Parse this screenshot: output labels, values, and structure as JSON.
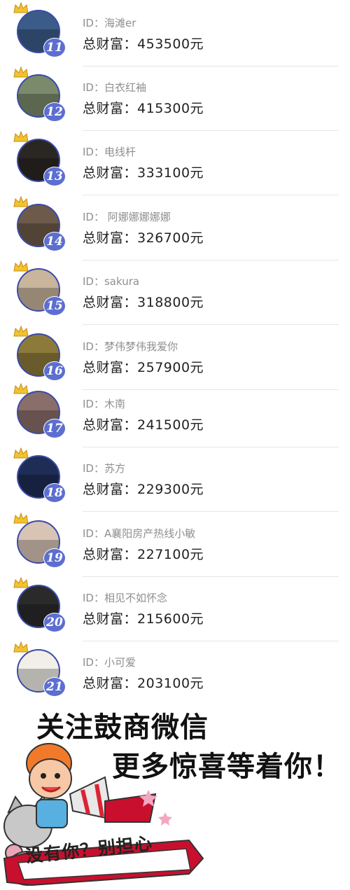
{
  "ranking": [
    {
      "rank": "11",
      "id_label": "ID：",
      "id": "海滩er",
      "wealth_label": "总财富：",
      "wealth": "453500元",
      "avatar_color": "#3b5c88"
    },
    {
      "rank": "12",
      "id_label": "ID：",
      "id": "白衣红袖",
      "wealth_label": "总财富：",
      "wealth": "415300元",
      "avatar_color": "#7a8a6a"
    },
    {
      "rank": "13",
      "id_label": "ID：",
      "id": "电线杆",
      "wealth_label": "总财富：",
      "wealth": "333100元",
      "avatar_color": "#2a2622"
    },
    {
      "rank": "14",
      "id_label": "ID：",
      "id": " 阿娜娜娜娜娜",
      "wealth_label": "总财富：",
      "wealth": "326700元",
      "avatar_color": "#6e5a4a"
    },
    {
      "rank": "15",
      "id_label": "ID：",
      "id": "sakura",
      "wealth_label": "总财富：",
      "wealth": "318800元",
      "avatar_color": "#c9b49c"
    },
    {
      "rank": "16",
      "id_label": "ID：",
      "id": "梦伟梦伟我爱你",
      "wealth_label": "总财富：",
      "wealth": "257900元",
      "avatar_color": "#8c7a3a"
    },
    {
      "rank": "17",
      "id_label": "ID：",
      "id": "木南",
      "wealth_label": "总财富：",
      "wealth": "241500元",
      "avatar_color": "#8a6e6a"
    },
    {
      "rank": "18",
      "id_label": "ID：",
      "id": "苏方",
      "wealth_label": "总财富：",
      "wealth": "229300元",
      "avatar_color": "#1e2c56"
    },
    {
      "rank": "19",
      "id_label": "ID：",
      "id": "A襄阳房产热线小敏",
      "wealth_label": "总财富：",
      "wealth": "227100元",
      "avatar_color": "#d7c4b4"
    },
    {
      "rank": "20",
      "id_label": "ID：",
      "id": "相见不如怀念",
      "wealth_label": "总财富：",
      "wealth": "215600元",
      "avatar_color": "#2a2a2a"
    },
    {
      "rank": "21",
      "id_label": "ID：",
      "id": "小可爱",
      "wealth_label": "总财富：",
      "wealth": "203100元",
      "avatar_color": "#f2efe8"
    }
  ],
  "promo": {
    "line1": "关注鼓商微信",
    "line2": "更多惊喜等着你！",
    "banner": "没有你？别担心"
  },
  "colors": {
    "rank_badge": "#5c6ed0",
    "avatar_border": "#3a4aa8",
    "crown": "#f2c230"
  }
}
